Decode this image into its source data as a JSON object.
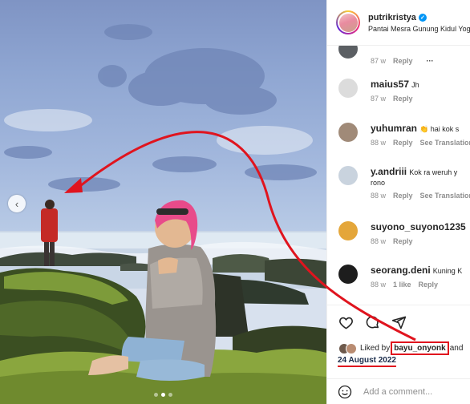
{
  "post": {
    "username": "putrikristya",
    "location": "Pantai Mesra Gunung Kidul Yogyakarta",
    "carousel_prev": "‹"
  },
  "comments": [
    {
      "user": "",
      "text": "",
      "time": "87 w",
      "reply": "Reply",
      "more": "···",
      "avatar_color": "#5b5f63"
    },
    {
      "user": "maius57",
      "text": "Jh",
      "time": "87 w",
      "reply": "Reply",
      "avatar_color": "#dcdcdc"
    },
    {
      "user": "yuhumran",
      "text": "👏 hai kok s",
      "time": "88 w",
      "reply": "Reply",
      "translate": "See Translation",
      "avatar_color": "#a08a78"
    },
    {
      "user": "y.andriii",
      "text": "Kok ra weruh y",
      "text2": "rono",
      "time": "88 w",
      "reply": "Reply",
      "translate": "See Translation",
      "avatar_color": "#c9d3de"
    },
    {
      "user": "suyono_suyono1235",
      "text": "",
      "time": "88 w",
      "reply": "Reply",
      "avatar_color": "#e4a63a"
    },
    {
      "user": "seorang.deni",
      "text": "Kuning K",
      "time": "88 w",
      "likes": "1 like",
      "reply": "Reply",
      "avatar_color": "#1d1d1d"
    }
  ],
  "likes": {
    "prefix": "Liked by",
    "user": "bayu_onyonk",
    "suffix": "and"
  },
  "date": "24 August 2022",
  "add_comment": {
    "placeholder": "Add a comment..."
  },
  "colors": {
    "annotation_red": "#e0141e",
    "verified_blue": "#0095f6"
  }
}
